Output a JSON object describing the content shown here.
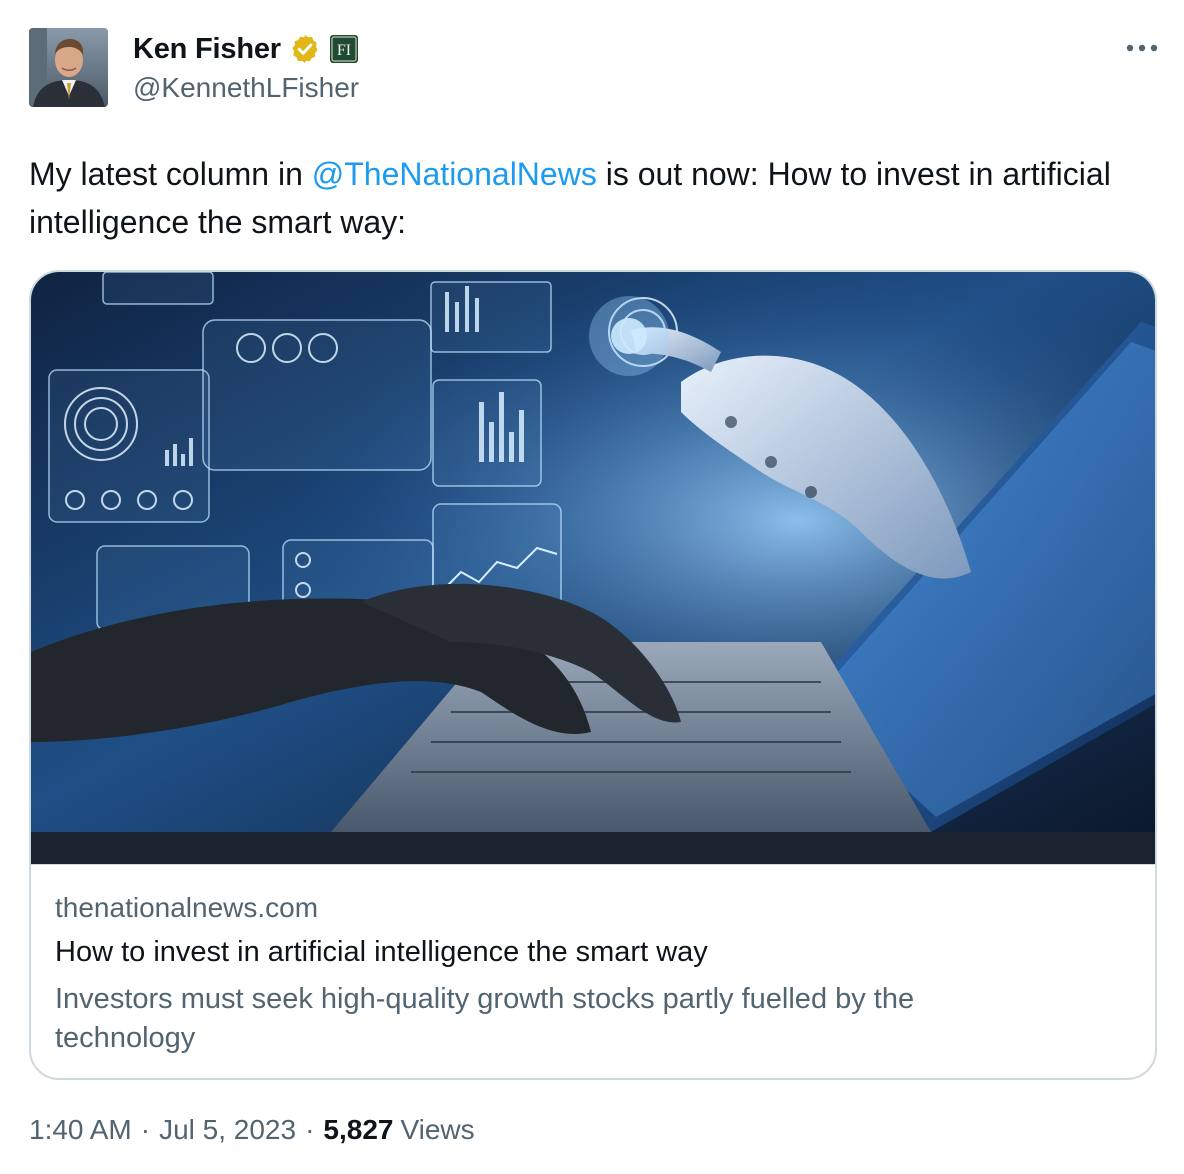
{
  "author": {
    "display_name": "Ken Fisher",
    "handle": "@KennethLFisher",
    "affiliation_badge_text": "FI",
    "avatar_icon": "profile-photo",
    "verified_badge_icon": "verified-checkmark-icon",
    "colors": {
      "verified_badge": "#e2b719"
    }
  },
  "more_icon": "more-horizontal-icon",
  "tweet": {
    "text_before": "My latest column in ",
    "mention": "@TheNationalNews",
    "text_after": " is out now: How to invest in artificial intelligence the smart way:"
  },
  "card": {
    "image_icon": "ai-robot-hand-laptop-image",
    "domain": "thenationalnews.com",
    "title": "How to invest in artificial intelligence the smart way",
    "description": "Investors must seek high-quality growth stocks partly fuelled by the technology"
  },
  "meta": {
    "time": "1:40 AM",
    "separator": "·",
    "date": "Jul 5, 2023",
    "views_count": "5,827",
    "views_label": "Views"
  },
  "colors": {
    "text_primary": "#0f1419",
    "text_secondary": "#536471",
    "link": "#1d9bf0",
    "border": "#cfd9de"
  }
}
